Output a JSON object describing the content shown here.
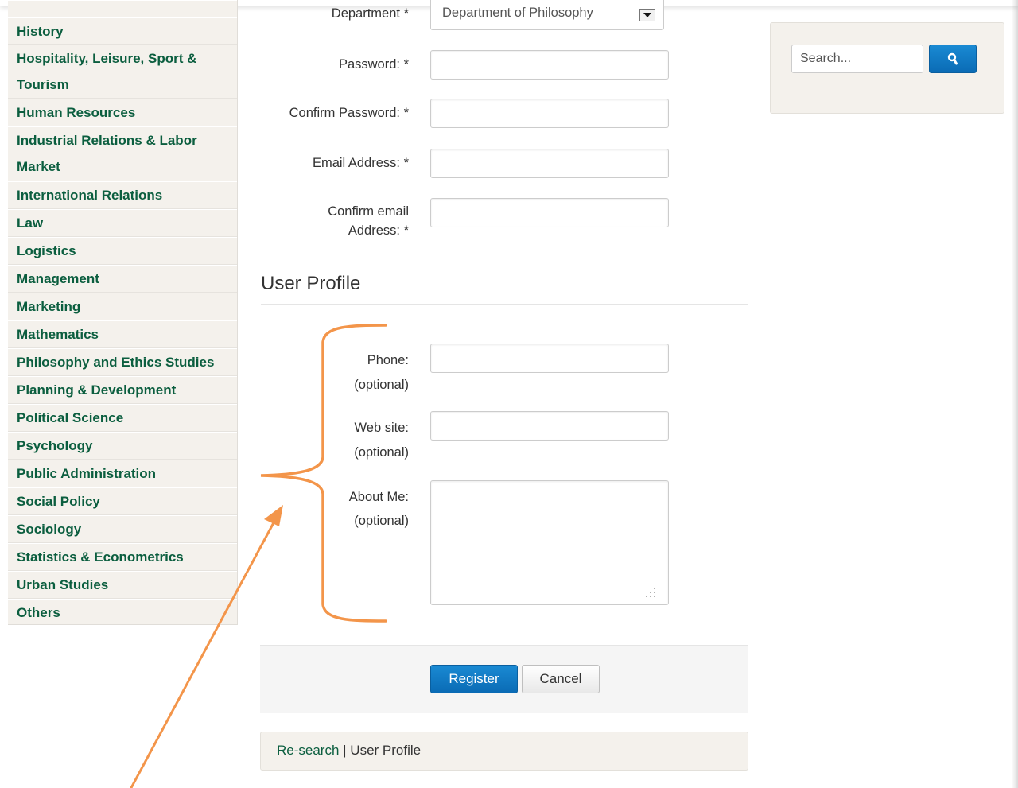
{
  "sidebar": {
    "items": [
      {
        "label": "History"
      },
      {
        "label": "Hospitality, Leisure, Sport &",
        "label2": "Tourism"
      },
      {
        "label": "Human Resources"
      },
      {
        "label": "Industrial Relations & Labor",
        "label2": "Market"
      },
      {
        "label": "International Relations"
      },
      {
        "label": "Law"
      },
      {
        "label": "Logistics"
      },
      {
        "label": "Management"
      },
      {
        "label": "Marketing"
      },
      {
        "label": "Mathematics"
      },
      {
        "label": "Philosophy and Ethics Studies"
      },
      {
        "label": "Planning & Development"
      },
      {
        "label": "Political Science"
      },
      {
        "label": "Psychology"
      },
      {
        "label": "Public Administration"
      },
      {
        "label": "Social Policy"
      },
      {
        "label": "Sociology"
      },
      {
        "label": "Statistics & Econometrics"
      },
      {
        "label": "Urban Studies"
      },
      {
        "label": "Others"
      }
    ]
  },
  "form": {
    "department": {
      "label": "Department *",
      "value": "Department of Philosophy"
    },
    "password": {
      "label": "Password: *",
      "value": ""
    },
    "confirm_password": {
      "label": "Confirm Password: *",
      "value": ""
    },
    "email": {
      "label": "Email Address: *",
      "value": ""
    },
    "confirm_email": {
      "label_line1": "Confirm email",
      "label_line2": "Address: *",
      "value": ""
    }
  },
  "profile": {
    "title": "User Profile",
    "phone": {
      "label": "Phone:",
      "hint": "(optional)",
      "value": ""
    },
    "website": {
      "label": "Web site:",
      "hint": "(optional)",
      "value": ""
    },
    "about": {
      "label": "About Me:",
      "hint": "(optional)",
      "value": ""
    }
  },
  "actions": {
    "register_label": "Register",
    "cancel_label": "Cancel"
  },
  "breadcrumb": {
    "link": "Re-search",
    "separator": " | ",
    "current": "User Profile"
  },
  "search": {
    "placeholder": "Search...",
    "icon": "search-icon"
  },
  "colors": {
    "accent_green": "#0b5e3f",
    "button_blue": "#0a6bb5",
    "annotation_orange": "#f3954a",
    "panel_beige": "#f4f1ec"
  }
}
